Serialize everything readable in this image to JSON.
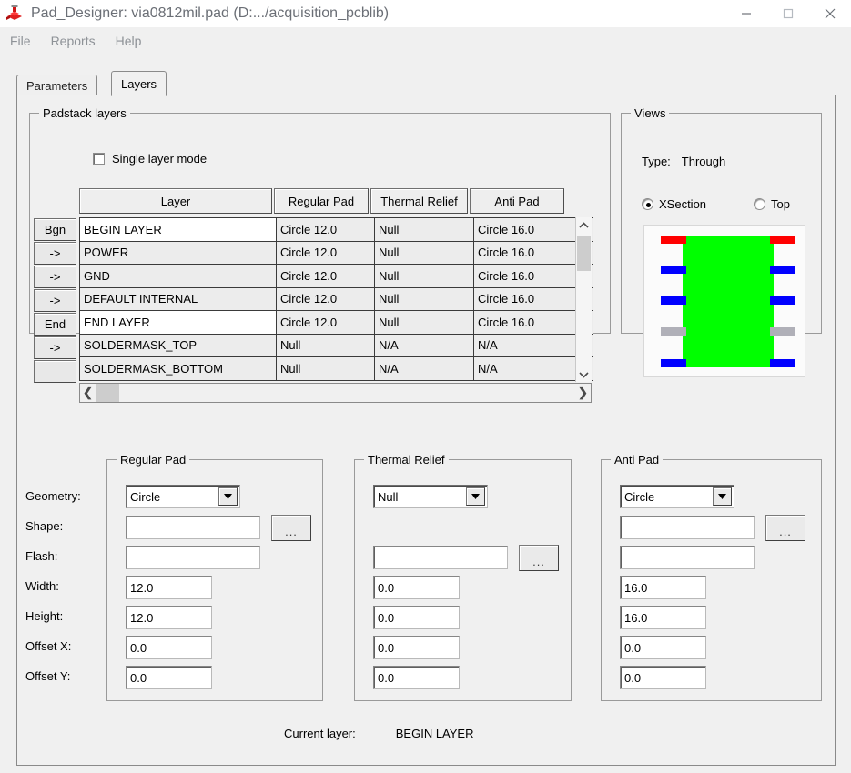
{
  "window": {
    "title": "Pad_Designer: via0812mil.pad (D:.../acquisition_pcblib)",
    "app_icon": "pad-designer-icon",
    "minimize_label": "minimize-icon",
    "maximize_label": "maximize-icon",
    "close_label": "close-icon"
  },
  "menu": {
    "items": [
      {
        "label": "File"
      },
      {
        "label": "Reports"
      },
      {
        "label": "Help"
      }
    ]
  },
  "tabs": [
    {
      "label": "Parameters",
      "active": false
    },
    {
      "label": "Layers",
      "active": true
    }
  ],
  "padstack": {
    "legend": "Padstack layers",
    "single_layer_mode": {
      "label": "Single layer mode",
      "checked": false
    },
    "columns": [
      "Layer",
      "Regular Pad",
      "Thermal Relief",
      "Anti Pad"
    ],
    "rows": [
      {
        "button": "Bgn",
        "layer": "BEGIN LAYER",
        "regular_pad": "Circle 12.0",
        "thermal_relief": "Null",
        "anti_pad": "Circle 16.0",
        "selected": false
      },
      {
        "button": "->",
        "layer": "POWER",
        "regular_pad": "Circle 12.0",
        "thermal_relief": "Null",
        "anti_pad": "Circle 16.0",
        "selected": false
      },
      {
        "button": "->",
        "layer": "GND",
        "regular_pad": "Circle 12.0",
        "thermal_relief": "Null",
        "anti_pad": "Circle 16.0",
        "selected": false
      },
      {
        "button": "->",
        "layer": "DEFAULT INTERNAL",
        "regular_pad": "Circle 12.0",
        "thermal_relief": "Null",
        "anti_pad": "Circle 16.0",
        "selected": false
      },
      {
        "button": "End",
        "layer": "END LAYER",
        "regular_pad": "Circle 12.0",
        "thermal_relief": "Null",
        "anti_pad": "Circle 16.0",
        "selected": true
      },
      {
        "button": "->",
        "layer": "SOLDERMASK_TOP",
        "regular_pad": "Null",
        "thermal_relief": "N/A",
        "anti_pad": "N/A",
        "selected": false
      },
      {
        "button": "",
        "layer": "SOLDERMASK_BOTTOM",
        "regular_pad": "Null",
        "thermal_relief": "N/A",
        "anti_pad": "N/A",
        "selected": false
      }
    ]
  },
  "views": {
    "legend": "Views",
    "type_label": "Type:",
    "type_value": "Through",
    "xsection_label": "XSection",
    "top_label": "Top",
    "selected_view": "XSection",
    "xsection_graphic": {
      "core_color": "#00ff00",
      "bars": [
        {
          "color": "#ff0000",
          "name": "begin-layer-bar"
        },
        {
          "color": "#0000ff",
          "name": "power-layer-bar"
        },
        {
          "color": "#0000ff",
          "name": "gnd-layer-bar"
        },
        {
          "color": "#b0b0b8",
          "name": "default-internal-layer-bar"
        },
        {
          "color": "#0000ff",
          "name": "end-layer-bar"
        }
      ]
    }
  },
  "field_labels": {
    "geometry": "Geometry:",
    "shape": "Shape:",
    "flash": "Flash:",
    "width": "Width:",
    "height": "Height:",
    "offset_x": "Offset X:",
    "offset_y": "Offset Y:",
    "ellipsis": "..."
  },
  "regular_pad": {
    "legend": "Regular Pad",
    "geometry": "Circle",
    "shape": "",
    "flash": "",
    "width": "12.0",
    "height": "12.0",
    "offset_x": "0.0",
    "offset_y": "0.0"
  },
  "thermal_relief": {
    "legend": "Thermal Relief",
    "geometry": "Null",
    "shape": "",
    "width": "0.0",
    "height": "0.0",
    "offset_x": "0.0",
    "offset_y": "0.0"
  },
  "anti_pad": {
    "legend": "Anti Pad",
    "geometry": "Circle",
    "shape": "",
    "flash": "",
    "width": "16.0",
    "height": "16.0",
    "offset_x": "0.0",
    "offset_y": "0.0"
  },
  "status": {
    "label": "Current layer:",
    "value": "BEGIN LAYER"
  }
}
